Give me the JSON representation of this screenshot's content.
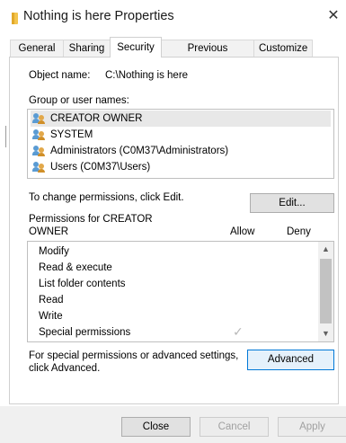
{
  "window": {
    "title": "Nothing is here Properties",
    "close_glyph": "✕"
  },
  "tabs": [
    {
      "label": "General"
    },
    {
      "label": "Sharing"
    },
    {
      "label": "Security",
      "active": true
    },
    {
      "label": "Previous Versions"
    },
    {
      "label": "Customize"
    }
  ],
  "security": {
    "object_name_label": "Object name:",
    "object_name_value": "C:\\Nothing is here",
    "group_label": "Group or user names:",
    "groups": [
      {
        "name": "CREATOR OWNER",
        "selected": true
      },
      {
        "name": "SYSTEM"
      },
      {
        "name": "Administrators (C0M37\\Administrators)"
      },
      {
        "name": "Users (C0M37\\Users)"
      }
    ],
    "change_hint": "To change permissions, click Edit.",
    "edit_button": "Edit...",
    "permissions_for_line1": "Permissions for CREATOR",
    "permissions_for_line2": "OWNER",
    "allow_header": "Allow",
    "deny_header": "Deny",
    "permissions": [
      {
        "name": "Modify"
      },
      {
        "name": "Read & execute"
      },
      {
        "name": "List folder contents"
      },
      {
        "name": "Read"
      },
      {
        "name": "Write"
      },
      {
        "name": "Special permissions",
        "allow": true
      }
    ],
    "check_glyph": "✓",
    "advanced_hint_line1": "For special permissions or advanced settings,",
    "advanced_hint_line2": "click Advanced.",
    "advanced_button": "Advanced"
  },
  "footer": {
    "close": "Close",
    "cancel": "Cancel",
    "apply": "Apply"
  },
  "colors": {
    "accent": "#0078d7",
    "selected_row": "#e8e8e8"
  }
}
